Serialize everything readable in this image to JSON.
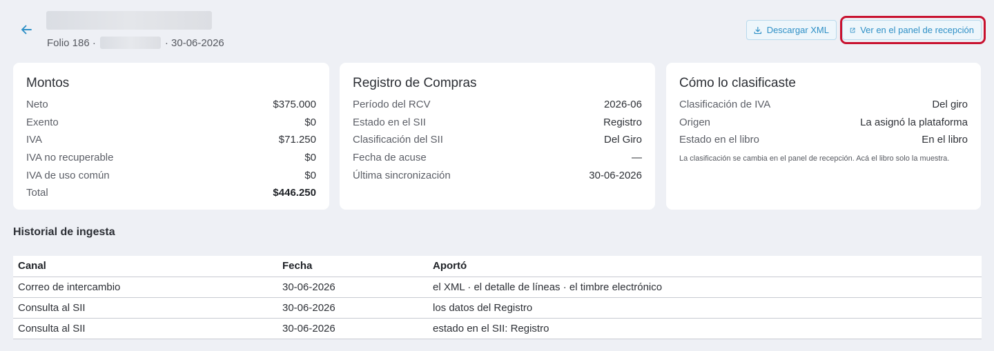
{
  "header": {
    "subtitle_folio": "Folio 186 ·",
    "subtitle_date": "· 30-06-2026"
  },
  "actions": {
    "download_xml": "Descargar XML",
    "view_panel": "Ver en el panel de recepción"
  },
  "montos": {
    "title": "Montos",
    "rows": [
      {
        "label": "Neto",
        "value": "$375.000"
      },
      {
        "label": "Exento",
        "value": "$0"
      },
      {
        "label": "IVA",
        "value": "$71.250"
      },
      {
        "label": "IVA no recuperable",
        "value": "$0"
      },
      {
        "label": "IVA de uso común",
        "value": "$0"
      },
      {
        "label": "Total",
        "value": "$446.250"
      }
    ]
  },
  "registro": {
    "title": "Registro de Compras",
    "rows": [
      {
        "label": "Período del RCV",
        "value": "2026-06"
      },
      {
        "label": "Estado en el SII",
        "value": "Registro"
      },
      {
        "label": "Clasificación del SII",
        "value": "Del Giro"
      },
      {
        "label": "Fecha de acuse",
        "value": "—"
      },
      {
        "label": "Última sincronización",
        "value": "30-06-2026"
      }
    ]
  },
  "clasificacion": {
    "title": "Cómo lo clasificaste",
    "rows": [
      {
        "label": "Clasificación de IVA",
        "value": "Del giro"
      },
      {
        "label": "Origen",
        "value": "La asignó la plataforma"
      },
      {
        "label": "Estado en el libro",
        "value": "En el libro"
      }
    ],
    "note": "La clasificación se cambia en el panel de recepción. Acá el libro solo la muestra."
  },
  "historial": {
    "title": "Historial de ingesta",
    "columns": [
      "Canal",
      "Fecha",
      "Aportó"
    ],
    "rows": [
      [
        "Correo de intercambio",
        "30-06-2026",
        "el XML · el detalle de líneas · el timbre electrónico"
      ],
      [
        "Consulta al SII",
        "30-06-2026",
        "los datos del Registro"
      ],
      [
        "Consulta al SII",
        "30-06-2026",
        "estado en el SII: Registro"
      ]
    ]
  },
  "colors": {
    "accent": "#2d8fc6",
    "highlight": "#c8102e",
    "background": "#eef0f5"
  },
  "icons": {
    "back": "arrow-left-icon",
    "download": "download-icon",
    "external": "external-link-icon"
  }
}
